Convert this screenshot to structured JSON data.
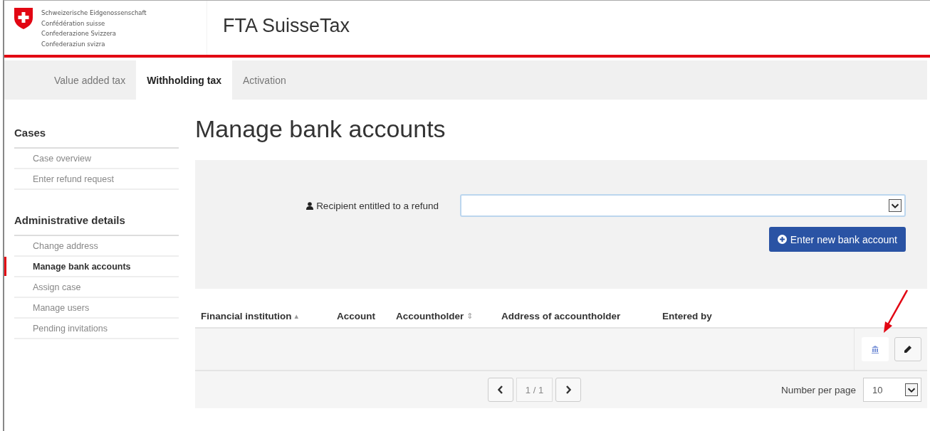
{
  "header": {
    "agency_lines": [
      "Schweizerische Eidgenossenschaft",
      "Confédération suisse",
      "Confederazione Svizzera",
      "Confederaziun svizra"
    ],
    "app_title": "FTA SuisseTax"
  },
  "tabs": [
    {
      "label": "Value added tax",
      "selected": false
    },
    {
      "label": "Withholding tax",
      "selected": true
    },
    {
      "label": "Activation",
      "selected": false
    }
  ],
  "sidebar": {
    "sections": [
      {
        "title": "Cases",
        "items": [
          {
            "label": "Case overview",
            "selected": false
          },
          {
            "label": "Enter refund request",
            "selected": false
          }
        ]
      },
      {
        "title": "Administrative details",
        "items": [
          {
            "label": "Change address",
            "selected": false
          },
          {
            "label": "Manage bank accounts",
            "selected": true
          },
          {
            "label": "Assign case",
            "selected": false
          },
          {
            "label": "Manage users",
            "selected": false
          },
          {
            "label": "Pending invitations",
            "selected": false
          }
        ]
      }
    ]
  },
  "page_title": "Manage bank accounts",
  "filter": {
    "label": "Recipient entitled to a refund",
    "button": "Enter new bank account"
  },
  "table": {
    "columns": [
      {
        "label": "Financial institution",
        "sort_mark": "▴"
      },
      {
        "label": "Account"
      },
      {
        "label": "Accountholder",
        "sort_mark": "⇕"
      },
      {
        "label": "Address of accountholder"
      },
      {
        "label": "Entered by"
      }
    ]
  },
  "pagination": {
    "page": "1 / 1",
    "per_page_label": "Number per page",
    "per_page": "10"
  }
}
